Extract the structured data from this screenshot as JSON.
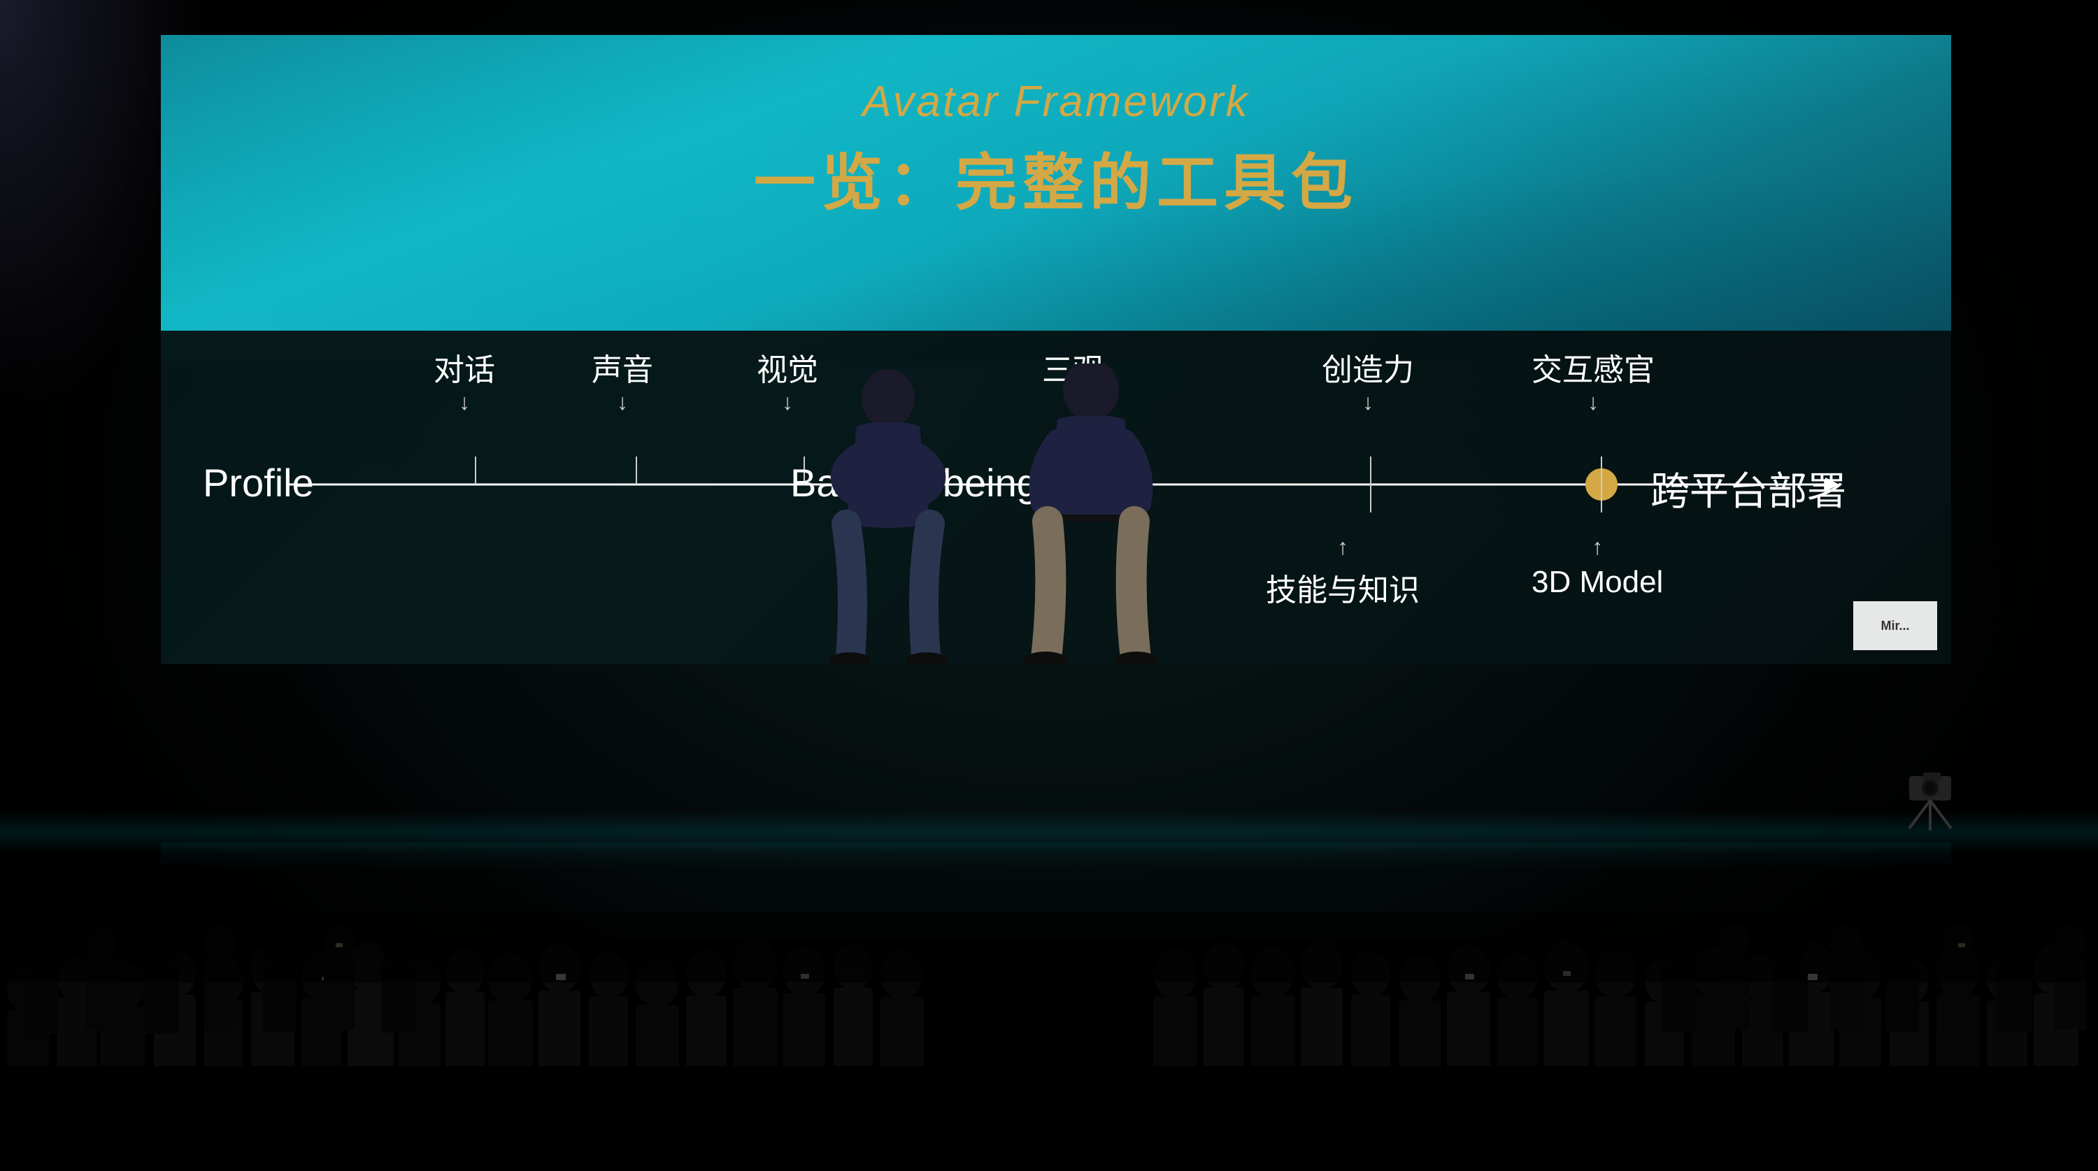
{
  "screen": {
    "title_english": "Avatar Framework",
    "title_chinese": "一览：完整的工具包",
    "title_color": "#d4a844"
  },
  "diagram": {
    "left_label": "Profile",
    "center_label": "Basic AI being",
    "right_label": "跨平台部署",
    "labels_above": [
      {
        "text": "对话",
        "position_pct": 18
      },
      {
        "text": "声音",
        "position_pct": 27
      },
      {
        "text": "视觉",
        "position_pct": 36
      },
      {
        "text": "三观",
        "position_pct": 52
      },
      {
        "text": "创造力",
        "position_pct": 68
      },
      {
        "text": "交互感官",
        "position_pct": 82
      }
    ],
    "labels_below": [
      {
        "text": "技能与知识",
        "position_pct": 68
      },
      {
        "text": "3D Model",
        "position_pct": 82
      }
    ],
    "dot_position_pct": 82,
    "dot_color": "#d4a844",
    "line_color": "#ffffff"
  },
  "info_box": {
    "text": "Mir..."
  }
}
